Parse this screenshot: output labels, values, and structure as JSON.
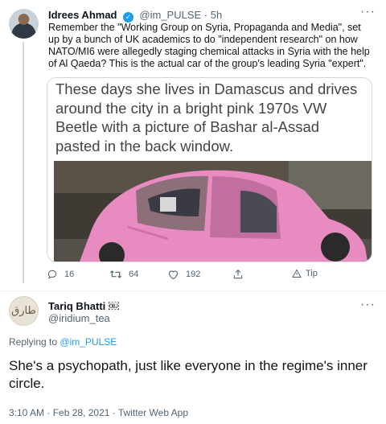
{
  "tweet": {
    "author_name": "Idrees Ahmad",
    "handle_time": "@im_PULSE · 5h",
    "text": "Remember the \"Working Group on Syria, Propaganda and Media\", set up by a bunch of UK academics to do \"independent research\" on how NATO/MI6 were allegedly staging chemical attacks in Syria with the help of Al Qaeda? This is the actual car of the group's leading Syria \"expert\".",
    "image_caption": "These days she lives in Damascus and drives around the city in a bright pink 1970s VW Beetle with a picture of Bashar al-Assad pasted in the back window.",
    "more": "···",
    "actions": {
      "replies": "16",
      "retweets": "64",
      "likes": "192",
      "tip": "Tip"
    }
  },
  "reply": {
    "author_name": "Tariq Bhatti ￼",
    "handle": "@iridium_tea",
    "replying_label": "Replying to",
    "replying_handle": "@im_PULSE",
    "text": "She's a psychopath, just like everyone in the regime's inner circle.",
    "meta": "3:10 AM · Feb 28, 2021 · Twitter Web App",
    "more": "···",
    "avatar_text": "ﻃﺎﺭﻕ"
  },
  "colors": {
    "accent": "#1d9bf0",
    "muted": "#536471",
    "car_pink": "#e88bc0"
  },
  "icons": [
    "verified-badge-icon",
    "reply-icon",
    "retweet-icon",
    "like-icon",
    "share-icon",
    "tip-icon",
    "more-icon"
  ]
}
